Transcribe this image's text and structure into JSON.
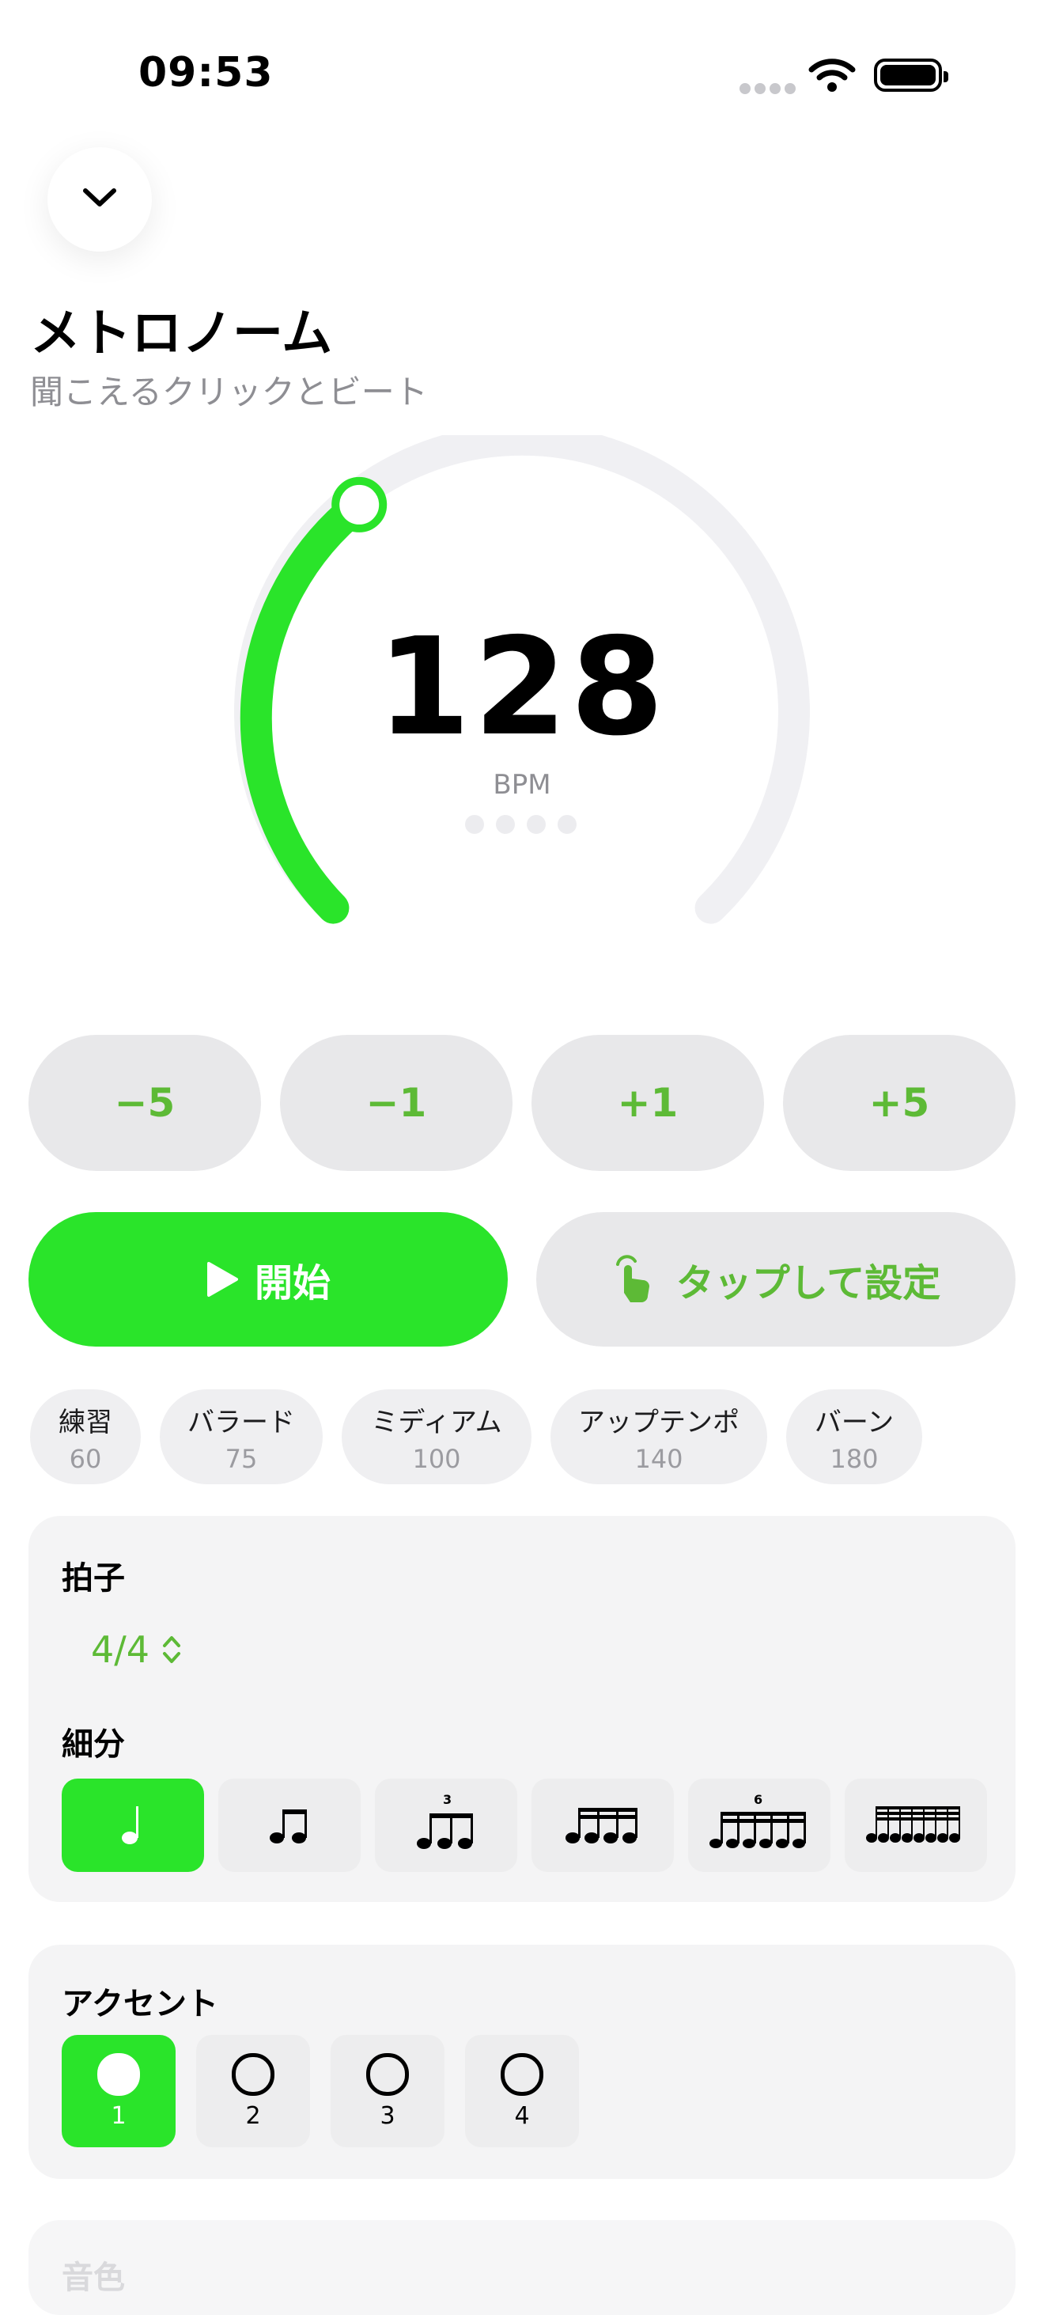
{
  "status_bar": {
    "time": "09:53"
  },
  "header": {
    "title": "メトロノーム",
    "subtitle": "聞こえるクリックとビート"
  },
  "tempo": {
    "bpm": "128",
    "unit": "BPM",
    "dial_fraction": 0.27
  },
  "steps": [
    "−5",
    "−1",
    "+1",
    "+5"
  ],
  "actions": {
    "start": "開始",
    "tap": "タップして設定"
  },
  "presets": [
    {
      "name": "練習",
      "bpm": "60"
    },
    {
      "name": "バラード",
      "bpm": "75"
    },
    {
      "name": "ミディアム",
      "bpm": "100"
    },
    {
      "name": "アップテンポ",
      "bpm": "140"
    },
    {
      "name": "バーン",
      "bpm": "180"
    }
  ],
  "time_signature": {
    "label": "拍子",
    "value": "4/4"
  },
  "subdivision": {
    "label": "細分",
    "options": [
      "quarter-note-icon",
      "eighth-notes-icon",
      "triplet-icon",
      "sixteenth-notes-icon",
      "sextuplet-icon",
      "thirty-second-notes-icon"
    ],
    "tuplet_labels": {
      "triplet": "3",
      "sextuplet": "6"
    },
    "selected_index": 0
  },
  "accent": {
    "label": "アクセント",
    "beats": [
      "1",
      "2",
      "3",
      "4"
    ],
    "selected_index": 0
  },
  "next_section": {
    "label": "音色"
  },
  "colors": {
    "accent_green": "#2ae42a",
    "text_green": "#5dba36",
    "track_gray": "#f0f0f3"
  }
}
